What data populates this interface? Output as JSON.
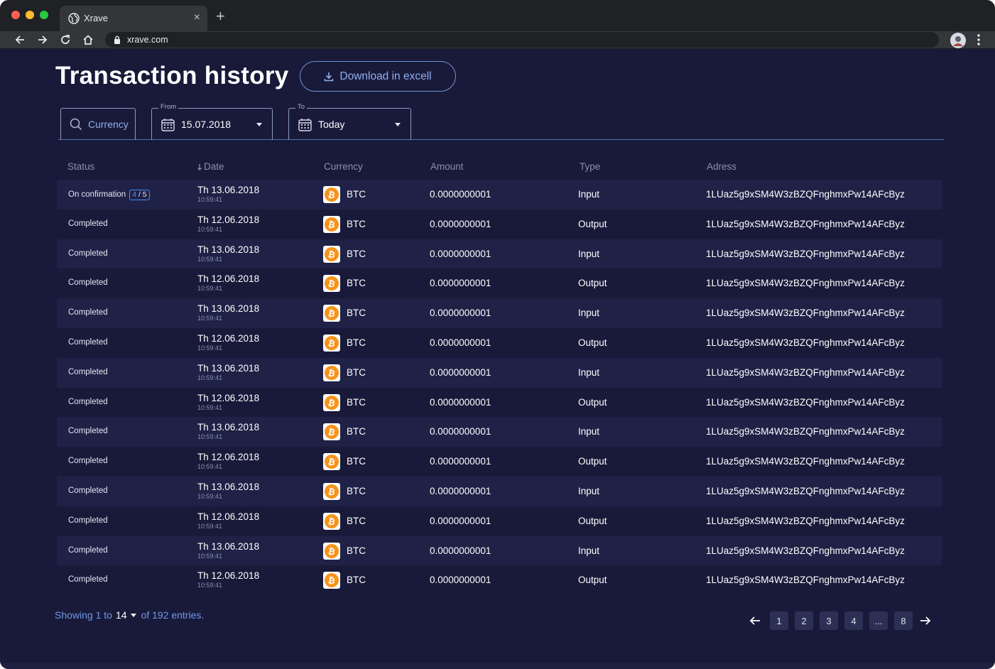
{
  "browser": {
    "tab_title": "Xrave",
    "url": "xrave.com"
  },
  "page": {
    "title": "Transaction history",
    "download_label": "Download in excell"
  },
  "filters": {
    "currency_placeholder": "Currency",
    "from_legend": "From",
    "from_value": "15.07.2018",
    "to_legend": "To",
    "to_value": "Today"
  },
  "table": {
    "headers": {
      "status": "Status",
      "date": "Date",
      "currency": "Currency",
      "amount": "Amount",
      "type": "Type",
      "address": "Adress"
    },
    "rows": [
      {
        "status": "On confirmation",
        "conf_current": "4",
        "conf_sep": " / ",
        "conf_total": "5",
        "date": "Th 13.06.2018",
        "time": "10:59:41",
        "currency": "BTC",
        "amount": "0.0000000001",
        "type": "Input",
        "address": "1LUaz5g9xSM4W3zBZQFnghmxPw14AFcByz"
      },
      {
        "status": "Completed",
        "date": "Th 12.06.2018",
        "time": "10:59:41",
        "currency": "BTC",
        "amount": "0.0000000001",
        "type": "Output",
        "address": "1LUaz5g9xSM4W3zBZQFnghmxPw14AFcByz"
      },
      {
        "status": "Completed",
        "date": "Th 13.06.2018",
        "time": "10:59:41",
        "currency": "BTC",
        "amount": "0.0000000001",
        "type": "Input",
        "address": "1LUaz5g9xSM4W3zBZQFnghmxPw14AFcByz"
      },
      {
        "status": "Completed",
        "date": "Th 12.06.2018",
        "time": "10:59:41",
        "currency": "BTC",
        "amount": "0.0000000001",
        "type": "Output",
        "address": "1LUaz5g9xSM4W3zBZQFnghmxPw14AFcByz"
      },
      {
        "status": "Completed",
        "date": "Th 13.06.2018",
        "time": "10:59:41",
        "currency": "BTC",
        "amount": "0.0000000001",
        "type": "Input",
        "address": "1LUaz5g9xSM4W3zBZQFnghmxPw14AFcByz"
      },
      {
        "status": "Completed",
        "date": "Th 12.06.2018",
        "time": "10:59:41",
        "currency": "BTC",
        "amount": "0.0000000001",
        "type": "Output",
        "address": "1LUaz5g9xSM4W3zBZQFnghmxPw14AFcByz"
      },
      {
        "status": "Completed",
        "date": "Th 13.06.2018",
        "time": "10:59:41",
        "currency": "BTC",
        "amount": "0.0000000001",
        "type": "Input",
        "address": "1LUaz5g9xSM4W3zBZQFnghmxPw14AFcByz"
      },
      {
        "status": "Completed",
        "date": "Th 12.06.2018",
        "time": "10:59:41",
        "currency": "BTC",
        "amount": "0.0000000001",
        "type": "Output",
        "address": "1LUaz5g9xSM4W3zBZQFnghmxPw14AFcByz"
      },
      {
        "status": "Completed",
        "date": "Th 13.06.2018",
        "time": "10:59:41",
        "currency": "BTC",
        "amount": "0.0000000001",
        "type": "Input",
        "address": "1LUaz5g9xSM4W3zBZQFnghmxPw14AFcByz"
      },
      {
        "status": "Completed",
        "date": "Th 12.06.2018",
        "time": "10:59:41",
        "currency": "BTC",
        "amount": "0.0000000001",
        "type": "Output",
        "address": "1LUaz5g9xSM4W3zBZQFnghmxPw14AFcByz"
      },
      {
        "status": "Completed",
        "date": "Th 13.06.2018",
        "time": "10:59:41",
        "currency": "BTC",
        "amount": "0.0000000001",
        "type": "Input",
        "address": "1LUaz5g9xSM4W3zBZQFnghmxPw14AFcByz"
      },
      {
        "status": "Completed",
        "date": "Th 12.06.2018",
        "time": "10:59:41",
        "currency": "BTC",
        "amount": "0.0000000001",
        "type": "Output",
        "address": "1LUaz5g9xSM4W3zBZQFnghmxPw14AFcByz"
      },
      {
        "status": "Completed",
        "date": "Th 13.06.2018",
        "time": "10:59:41",
        "currency": "BTC",
        "amount": "0.0000000001",
        "type": "Input",
        "address": "1LUaz5g9xSM4W3zBZQFnghmxPw14AFcByz"
      },
      {
        "status": "Completed",
        "date": "Th 12.06.2018",
        "time": "10:59:41",
        "currency": "BTC",
        "amount": "0.0000000001",
        "type": "Output",
        "address": "1LUaz5g9xSM4W3zBZQFnghmxPw14AFcByz"
      }
    ]
  },
  "footer": {
    "showing_prefix": "Showing 1 to",
    "page_size": "14",
    "showing_suffix": "of 192 entries.",
    "pages": [
      "1",
      "2",
      "3",
      "4",
      "...",
      "8"
    ]
  },
  "icons": {
    "coin": "bitcoin-icon",
    "download": "download-icon",
    "search": "search-icon",
    "calendar": "calendar-icon",
    "sort": "sort-arrow-down-icon"
  },
  "colors": {
    "background": "#191a3a",
    "row_alt": "#1f2146",
    "accent_blue": "#6f98e6",
    "bitcoin": "#f7931a"
  }
}
